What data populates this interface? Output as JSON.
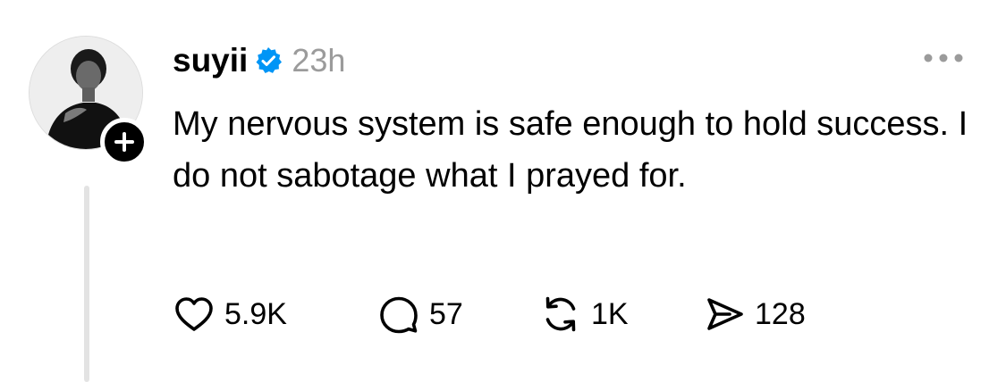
{
  "post": {
    "author": {
      "username": "suyii",
      "verified": true,
      "avatar_icon": "avatar-portrait"
    },
    "timestamp": "23h",
    "text": "My nervous system is safe enough to hold success. I do not sabotage what I prayed for.",
    "actions": {
      "likes": "5.9K",
      "replies": "57",
      "reposts": "1K",
      "shares": "128"
    }
  },
  "icons": {
    "verified": "verified-badge-icon",
    "more": "more-options-icon",
    "follow": "plus-icon",
    "like": "heart-icon",
    "reply": "comment-bubble-icon",
    "repost": "repost-icon",
    "share": "send-icon"
  },
  "colors": {
    "verified_blue": "#0095f6",
    "timestamp_gray": "#9b9b9b",
    "thread_line": "#e3e3e3"
  }
}
